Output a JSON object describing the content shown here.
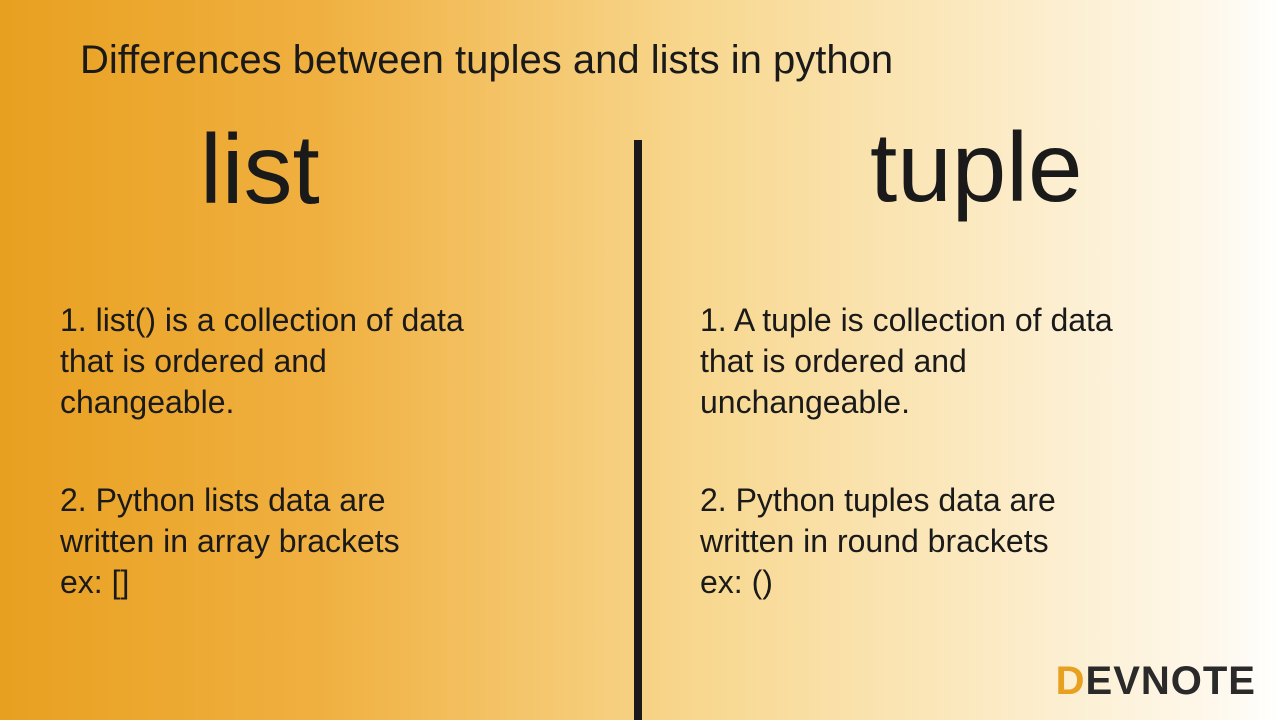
{
  "title": "Differences between tuples and lists in python",
  "left": {
    "heading": "list",
    "point1": "1. list() is a collection of data\n that is ordered and\nchangeable.",
    "point2": "2. Python lists data are\nwritten in array brackets\nex: []"
  },
  "right": {
    "heading": "tuple",
    "point1": "1. A tuple is collection of data\nthat is ordered and\nunchangeable.",
    "point2": "2. Python tuples data are\nwritten in round brackets\n ex: ()"
  },
  "logo": {
    "first": "D",
    "rest": "EVNOTE"
  }
}
